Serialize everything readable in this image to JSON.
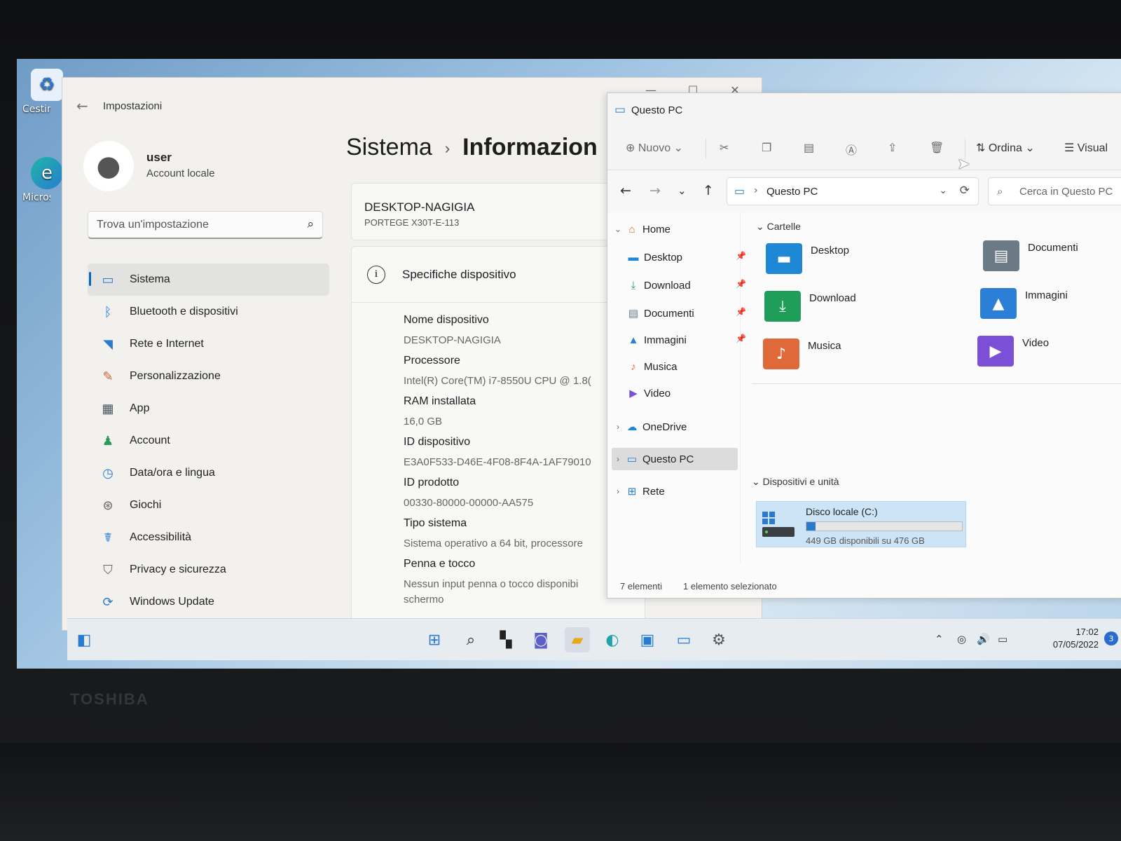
{
  "device_brand": "TOSHIBA",
  "desktop": {
    "icons": [
      {
        "label": "Cestino",
        "icon": "recycle-bin-icon"
      },
      {
        "label": "Microsoft Edge",
        "icon": "edge-icon"
      }
    ]
  },
  "settings": {
    "app_title": "Impostazioni",
    "user": {
      "name": "user",
      "type": "Account locale"
    },
    "search_placeholder": "Trova un'impostazione",
    "nav": [
      {
        "label": "Sistema",
        "icon": "monitor-icon",
        "active": true
      },
      {
        "label": "Bluetooth e dispositivi",
        "icon": "bluetooth-icon"
      },
      {
        "label": "Rete e Internet",
        "icon": "wifi-icon"
      },
      {
        "label": "Personalizzazione",
        "icon": "brush-icon"
      },
      {
        "label": "App",
        "icon": "apps-icon"
      },
      {
        "label": "Account",
        "icon": "person-icon"
      },
      {
        "label": "Data/ora e lingua",
        "icon": "clock-globe-icon"
      },
      {
        "label": "Giochi",
        "icon": "gamepad-icon"
      },
      {
        "label": "Accessibilità",
        "icon": "accessibility-icon"
      },
      {
        "label": "Privacy e sicurezza",
        "icon": "shield-icon"
      },
      {
        "label": "Windows Update",
        "icon": "update-icon"
      }
    ],
    "breadcrumb": {
      "parent": "Sistema",
      "current": "Informazion"
    },
    "device_card": {
      "name": "DESKTOP-NAGIGIA",
      "model": "PORTEGE X30T-E-113"
    },
    "specs": {
      "title": "Specifiche dispositivo",
      "items": [
        {
          "label": "Nome dispositivo",
          "value": "DESKTOP-NAGIGIA"
        },
        {
          "label": "Processore",
          "value": "Intel(R) Core(TM) i7-8550U CPU @ 1.8("
        },
        {
          "label": "RAM installata",
          "value": "16,0 GB"
        },
        {
          "label": "ID dispositivo",
          "value": "E3A0F533-D46E-4F08-8F4A-1AF79010"
        },
        {
          "label": "ID prodotto",
          "value": "00330-80000-00000-AA575"
        },
        {
          "label": "Tipo sistema",
          "value": "Sistema operativo a 64 bit, processore"
        },
        {
          "label": "Penna e tocco",
          "value": "Nessun input penna o tocco disponibi",
          "value2": "schermo"
        }
      ]
    }
  },
  "explorer": {
    "title": "Questo PC",
    "toolbar": {
      "new": "Nuovo",
      "sort": "Ordina",
      "view": "Visual"
    },
    "address": "Questo PC",
    "search_placeholder": "Cerca in Questo PC",
    "tree": [
      {
        "label": "Home",
        "icon": "home-icon",
        "expanded": true
      },
      {
        "label": "Desktop",
        "icon": "desktop-folder-icon",
        "pinned": true
      },
      {
        "label": "Download",
        "icon": "download-icon",
        "pinned": true
      },
      {
        "label": "Documenti",
        "icon": "document-icon",
        "pinned": true
      },
      {
        "label": "Immagini",
        "icon": "pictures-icon",
        "pinned": true
      },
      {
        "label": "Musica",
        "icon": "music-icon"
      },
      {
        "label": "Video",
        "icon": "video-icon"
      },
      {
        "label": "OneDrive",
        "icon": "cloud-icon"
      },
      {
        "label": "Questo PC",
        "icon": "pc-icon",
        "selected": true
      },
      {
        "label": "Rete",
        "icon": "network-icon"
      }
    ],
    "folders_header": "Cartelle",
    "folders": [
      {
        "label": "Desktop",
        "icon": "desktop-folder-icon",
        "color": "#1e88d6"
      },
      {
        "label": "Documenti",
        "icon": "document-folder-icon",
        "color": "#6c7a86"
      },
      {
        "label": "Download",
        "icon": "download-folder-icon",
        "color": "#1f9e5a"
      },
      {
        "label": "Immagini",
        "icon": "pictures-folder-icon",
        "color": "#2b7fd6"
      },
      {
        "label": "Musica",
        "icon": "music-folder-icon",
        "color": "#e0693a"
      },
      {
        "label": "Video",
        "icon": "video-folder-icon",
        "color": "#7b4fd6"
      }
    ],
    "devices_header": "Dispositivi e unità",
    "drive": {
      "name": "Disco locale (C:)",
      "free": "449 GB disponibili su 476 GB",
      "used_fraction": 0.057
    },
    "status": {
      "count": "7 elementi",
      "selected": "1 elemento selezionato"
    }
  },
  "taskbar": {
    "apps": [
      "start-icon",
      "search-icon",
      "task-view-icon",
      "chat-icon",
      "file-explorer-icon",
      "edge-icon",
      "store-icon",
      "remote-desktop-icon",
      "settings-icon"
    ],
    "time": "17:02",
    "date": "07/05/2022",
    "notifications": "3"
  }
}
